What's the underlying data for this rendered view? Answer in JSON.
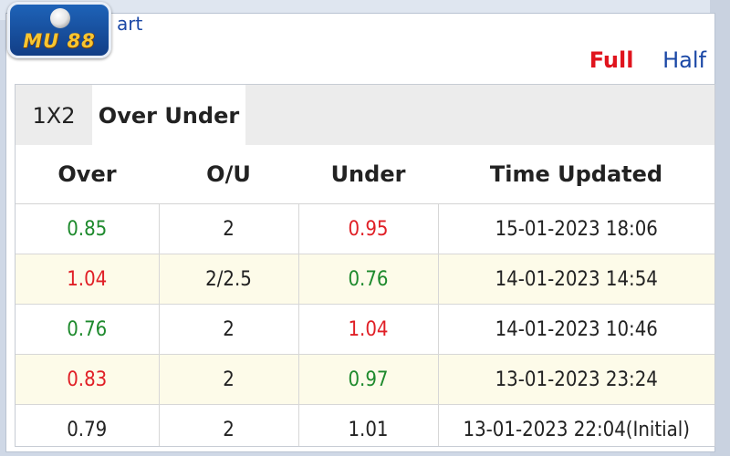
{
  "logo": {
    "text": "MU 88"
  },
  "header": {
    "chart_link_fragment": "art"
  },
  "mode_toggle": {
    "full": "Full",
    "half": "Half"
  },
  "tabs": [
    {
      "label": "1X2",
      "active": false
    },
    {
      "label": "Over Under",
      "active": true
    }
  ],
  "table": {
    "headers": [
      "Over",
      "O/U",
      "Under",
      "Time Updated"
    ],
    "rows": [
      {
        "over": "0.85",
        "over_color": "green",
        "ou": "2",
        "under": "0.95",
        "under_color": "red",
        "time": "15-01-2023 18:06"
      },
      {
        "over": "1.04",
        "over_color": "red",
        "ou": "2/2.5",
        "under": "0.76",
        "under_color": "green",
        "time": "14-01-2023 14:54"
      },
      {
        "over": "0.76",
        "over_color": "green",
        "ou": "2",
        "under": "1.04",
        "under_color": "red",
        "time": "14-01-2023 10:46"
      },
      {
        "over": "0.83",
        "over_color": "red",
        "ou": "2",
        "under": "0.97",
        "under_color": "green",
        "time": "13-01-2023 23:24"
      },
      {
        "over": "0.79",
        "over_color": "black",
        "ou": "2",
        "under": "1.01",
        "under_color": "black",
        "time": "13-01-2023 22:04(Initial)"
      }
    ]
  },
  "colors": {
    "up": "#e01f26",
    "down": "#1e8a2d",
    "accent": "#1b48a6",
    "highlight_row": "#fdfbe9"
  }
}
